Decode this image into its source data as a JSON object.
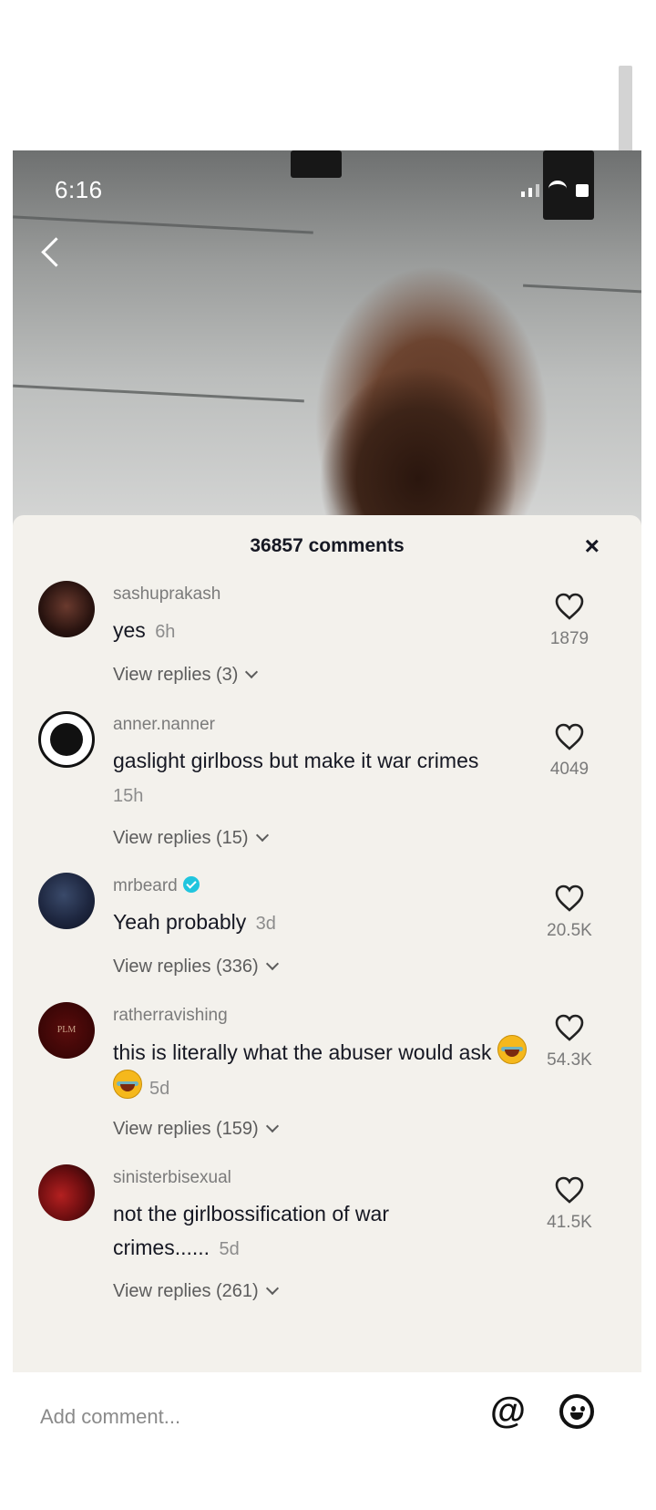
{
  "status_bar": {
    "time": "6:16"
  },
  "comments_panel": {
    "title": "36857 comments",
    "close_label": "×",
    "comments": [
      {
        "username": "sashuprakash",
        "verified": false,
        "text": "yes",
        "time": "6h",
        "replies": "View replies (3)",
        "likes": "1879"
      },
      {
        "username": "anner.nanner",
        "verified": false,
        "text": "gaslight girlboss but make it war crimes",
        "time": "15h",
        "replies": "View replies (15)",
        "likes": "4049"
      },
      {
        "username": "mrbeard",
        "verified": true,
        "text": "Yeah probably",
        "time": "3d",
        "replies": "View replies (336)",
        "likes": "20.5K"
      },
      {
        "username": "ratherravishing",
        "verified": false,
        "text": "this is literally what the abuser would ask",
        "time": "5d",
        "replies": "View replies (159)",
        "likes": "54.3K",
        "avatar_text": "PLM"
      },
      {
        "username": "sinisterbisexual",
        "verified": false,
        "text": "not the girlbossification of war crimes......",
        "time": "5d",
        "replies": "View replies (261)",
        "likes": "41.5K"
      }
    ]
  },
  "composer": {
    "placeholder": "Add comment...",
    "mention_label": "@"
  },
  "colors": {
    "panel_bg": "#f3f1ec",
    "verified": "#20c5de",
    "text": "#161823"
  }
}
